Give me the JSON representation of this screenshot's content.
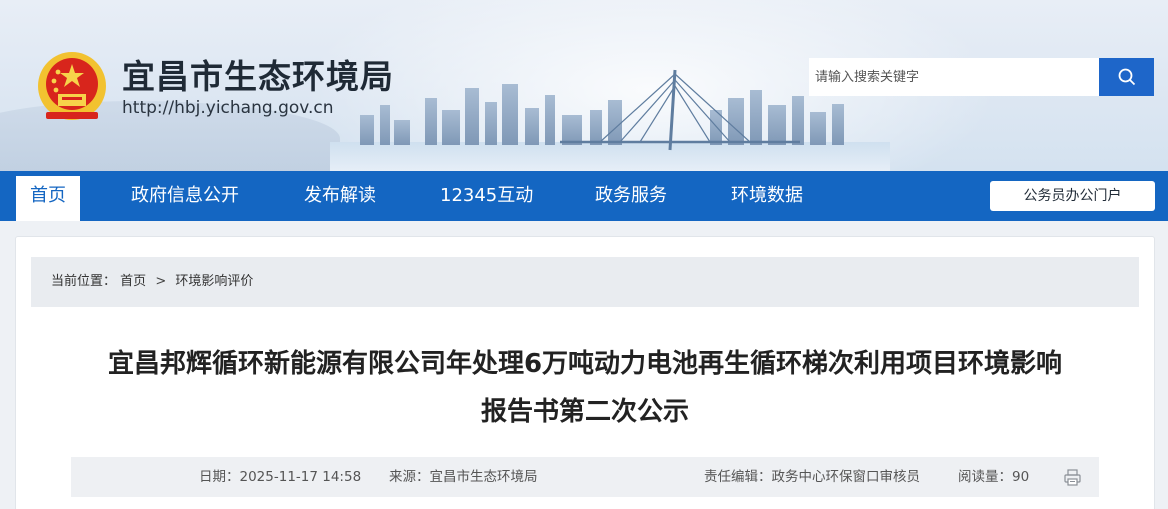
{
  "header": {
    "site_title": "宜昌市生态环境局",
    "site_url": "http://hbj.yichang.gov.cn",
    "emblem_icon": "national-emblem-icon"
  },
  "search": {
    "placeholder": "请输入搜索关键字",
    "button_icon": "search-icon"
  },
  "nav": {
    "items": [
      {
        "label": "首页",
        "active": true
      },
      {
        "label": "政府信息公开"
      },
      {
        "label": "发布解读"
      },
      {
        "label": "12345互动"
      },
      {
        "label": "政务服务"
      },
      {
        "label": "环境数据"
      }
    ],
    "portal_label": "公务员办公门户"
  },
  "breadcrumb": {
    "prefix": "当前位置：",
    "items": [
      "首页",
      "环境影响评价"
    ],
    "separator": ">"
  },
  "article": {
    "title_line1": "宜昌邦辉循环新能源有限公司年处理6万吨动力电池再生循环梯次利用项目环境影响",
    "title_line2": "报告书第二次公示"
  },
  "meta": {
    "date_label": "日期：",
    "date": "2025-11-17 14:58",
    "source_label": "来源：",
    "source": "宜昌市生态环境局",
    "editor_label": "责任编辑：",
    "editor": "政务中心环保窗口审核员",
    "views_label": "阅读量：",
    "views": "90",
    "print_icon": "print-icon"
  },
  "colors": {
    "nav_blue": "#1466c2",
    "search_blue": "#1e66c9",
    "breadcrumb_bg": "#e9ecf0",
    "meta_bg": "#eef0f3"
  }
}
